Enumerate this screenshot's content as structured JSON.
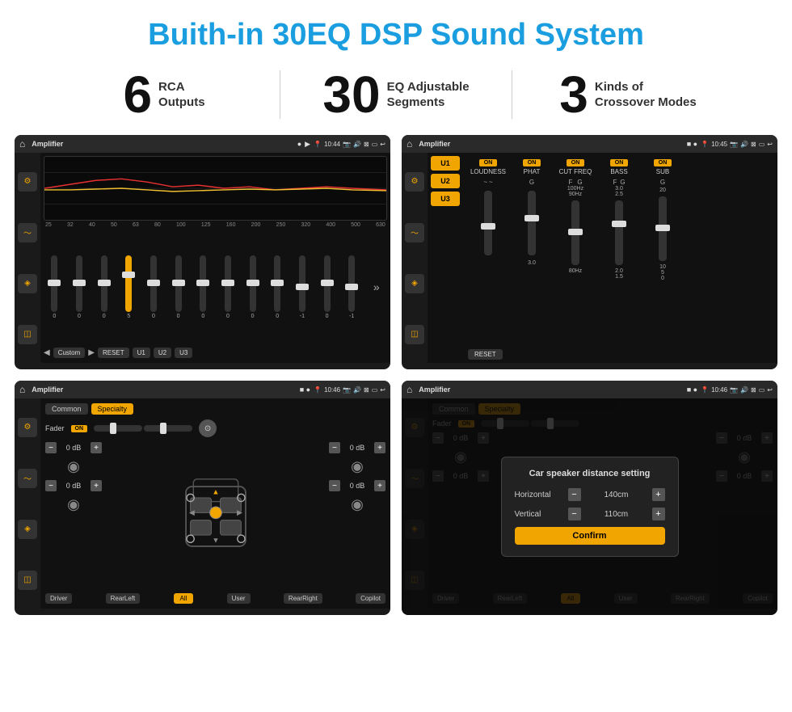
{
  "page": {
    "title": "Buith-in 30EQ DSP Sound System",
    "stats": [
      {
        "number": "6",
        "label": "RCA\nOutputs"
      },
      {
        "number": "30",
        "label": "EQ Adjustable\nSegments"
      },
      {
        "number": "3",
        "label": "Kinds of\nCrossover Modes"
      }
    ]
  },
  "screens": {
    "eq": {
      "status_title": "Amplifier",
      "time": "10:44",
      "freq_labels": [
        "25",
        "32",
        "40",
        "50",
        "63",
        "80",
        "100",
        "125",
        "160",
        "200",
        "250",
        "320",
        "400",
        "500",
        "630"
      ],
      "slider_values": [
        "0",
        "0",
        "0",
        "5",
        "0",
        "0",
        "0",
        "0",
        "0",
        "0",
        "-1",
        "0",
        "-1"
      ],
      "buttons": [
        "Custom",
        "RESET",
        "U1",
        "U2",
        "U3"
      ]
    },
    "crossover": {
      "status_title": "Amplifier",
      "time": "10:45",
      "presets": [
        "U1",
        "U2",
        "U3"
      ],
      "channels": [
        "LOUDNESS",
        "PHAT",
        "CUT FREQ",
        "BASS",
        "SUB"
      ]
    },
    "fader": {
      "status_title": "Amplifier",
      "time": "10:46",
      "tabs": [
        "Common",
        "Specialty"
      ],
      "fader_label": "Fader",
      "db_values": [
        "0 dB",
        "0 dB",
        "0 dB",
        "0 dB"
      ],
      "buttons": [
        "Driver",
        "RearLeft",
        "All",
        "User",
        "RearRight",
        "Copilot"
      ]
    },
    "dialog": {
      "status_title": "Amplifier",
      "time": "10:46",
      "tabs": [
        "Common",
        "Specialty"
      ],
      "dialog_title": "Car speaker distance setting",
      "horizontal_label": "Horizontal",
      "horizontal_value": "140cm",
      "vertical_label": "Vertical",
      "vertical_value": "110cm",
      "confirm_label": "Confirm",
      "db_values": [
        "0 dB",
        "0 dB"
      ],
      "buttons": [
        "Driver",
        "RearLeft",
        "RearRight",
        "Copilot"
      ]
    }
  }
}
